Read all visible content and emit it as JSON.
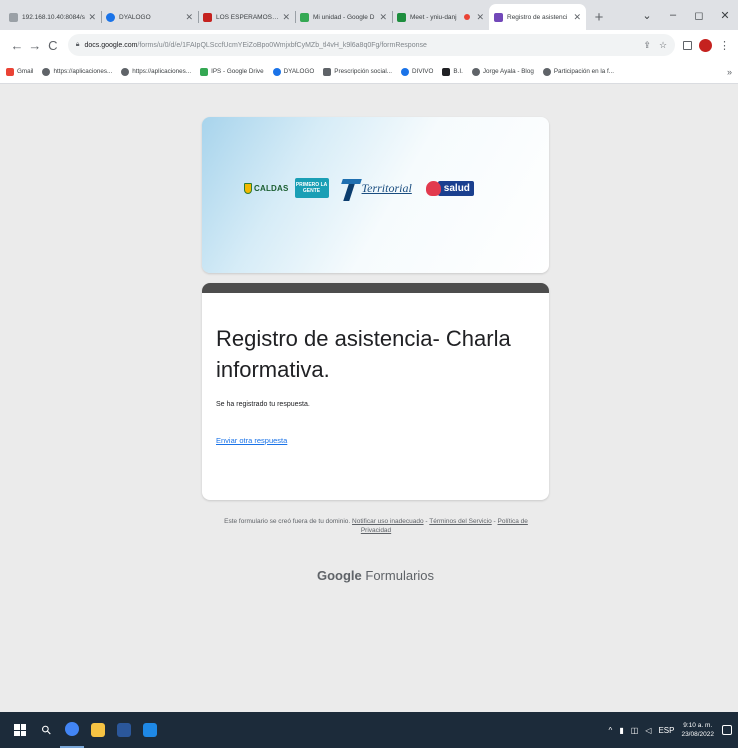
{
  "browser": {
    "tabs": [
      {
        "title": "192.168.10.40:8084/s",
        "favicon_color": "#9aa0a6",
        "active": false,
        "recording": false
      },
      {
        "title": "DYALOGO",
        "favicon_color": "#1a73e8",
        "active": false,
        "recording": false
      },
      {
        "title": "LOS ESPERAMOS O...",
        "favicon_color": "#c5221f",
        "active": false,
        "recording": false
      },
      {
        "title": "Mi unidad - Google D",
        "favicon_color": "#34a853",
        "active": false,
        "recording": false
      },
      {
        "title": "Meet - yniu-danj",
        "favicon_color": "#1e8e3e",
        "active": false,
        "recording": true
      },
      {
        "title": "Registro de asistenci",
        "favicon_color": "#7248b9",
        "active": true,
        "recording": false
      }
    ],
    "new_tab_glyph": "+",
    "window_controls": {
      "tab_search": "⌄",
      "minimize": "–",
      "maximize": "◻",
      "close": "✕"
    },
    "nav": {
      "back": "←",
      "forward": "→",
      "reload": "C"
    },
    "address": {
      "host": "docs.google.com",
      "path": "/forms/u/0/d/e/1FAIpQLSccfUcmYEiZoBpo0WmjxbfCyMZb_tl4vH_k9l6a8q0Fg/formResponse"
    },
    "toolbar_icons": {
      "share": "share-icon",
      "star": "star-icon",
      "extensions": "extensions-icon",
      "profile": "profile-avatar",
      "menu": "⋮"
    },
    "bookmarks": [
      {
        "label": "Gmail",
        "color": "#ea4335"
      },
      {
        "label": "https://aplicaciones...",
        "color": "#5f6368"
      },
      {
        "label": "https://aplicaciones...",
        "color": "#5f6368"
      },
      {
        "label": "IPS - Google Drive",
        "color": "#34a853"
      },
      {
        "label": "DYALOGO",
        "color": "#1a73e8"
      },
      {
        "label": "Prescripción social...",
        "color": "#5f6368"
      },
      {
        "label": "DIVIVO",
        "color": "#1a73e8"
      },
      {
        "label": "B.I.",
        "color": "#202124"
      },
      {
        "label": "Jorge Ayala - Blog",
        "color": "#5f6368"
      },
      {
        "label": "Participación en la f...",
        "color": "#5f6368"
      }
    ],
    "bookmarks_more": "»"
  },
  "form": {
    "logos": {
      "caldas": "CALDAS",
      "primero": "PRIMERO LA GENTE",
      "territorial": "Territorial",
      "salud": "salud"
    },
    "title": "Registro de asistencia- Charla informativa.",
    "confirmation": "Se ha registrado tu respuesta.",
    "another_link": "Enviar otra respuesta",
    "accent_color": "#4d4d4d",
    "link_color": "#1a73e8"
  },
  "footer": {
    "note": "Este formulario se creó fuera de tu dominio.",
    "report": "Notificar uso inadecuado",
    "terms": "Términos del Servicio",
    "privacy": "Política de Privacidad",
    "brand_google": "Google",
    "brand_product": "Formularios"
  },
  "taskbar": {
    "apps": [
      {
        "name": "chrome",
        "color": "#4285f4",
        "active": true
      },
      {
        "name": "file-explorer",
        "color": "#f6c343",
        "active": false
      },
      {
        "name": "word",
        "color": "#2b579a",
        "active": false
      },
      {
        "name": "photos",
        "color": "#1e88e5",
        "active": false
      }
    ],
    "tray": {
      "chevron": "^",
      "language": "ESP"
    },
    "time": "9:10 a. m.",
    "date": "23/08/2022"
  }
}
